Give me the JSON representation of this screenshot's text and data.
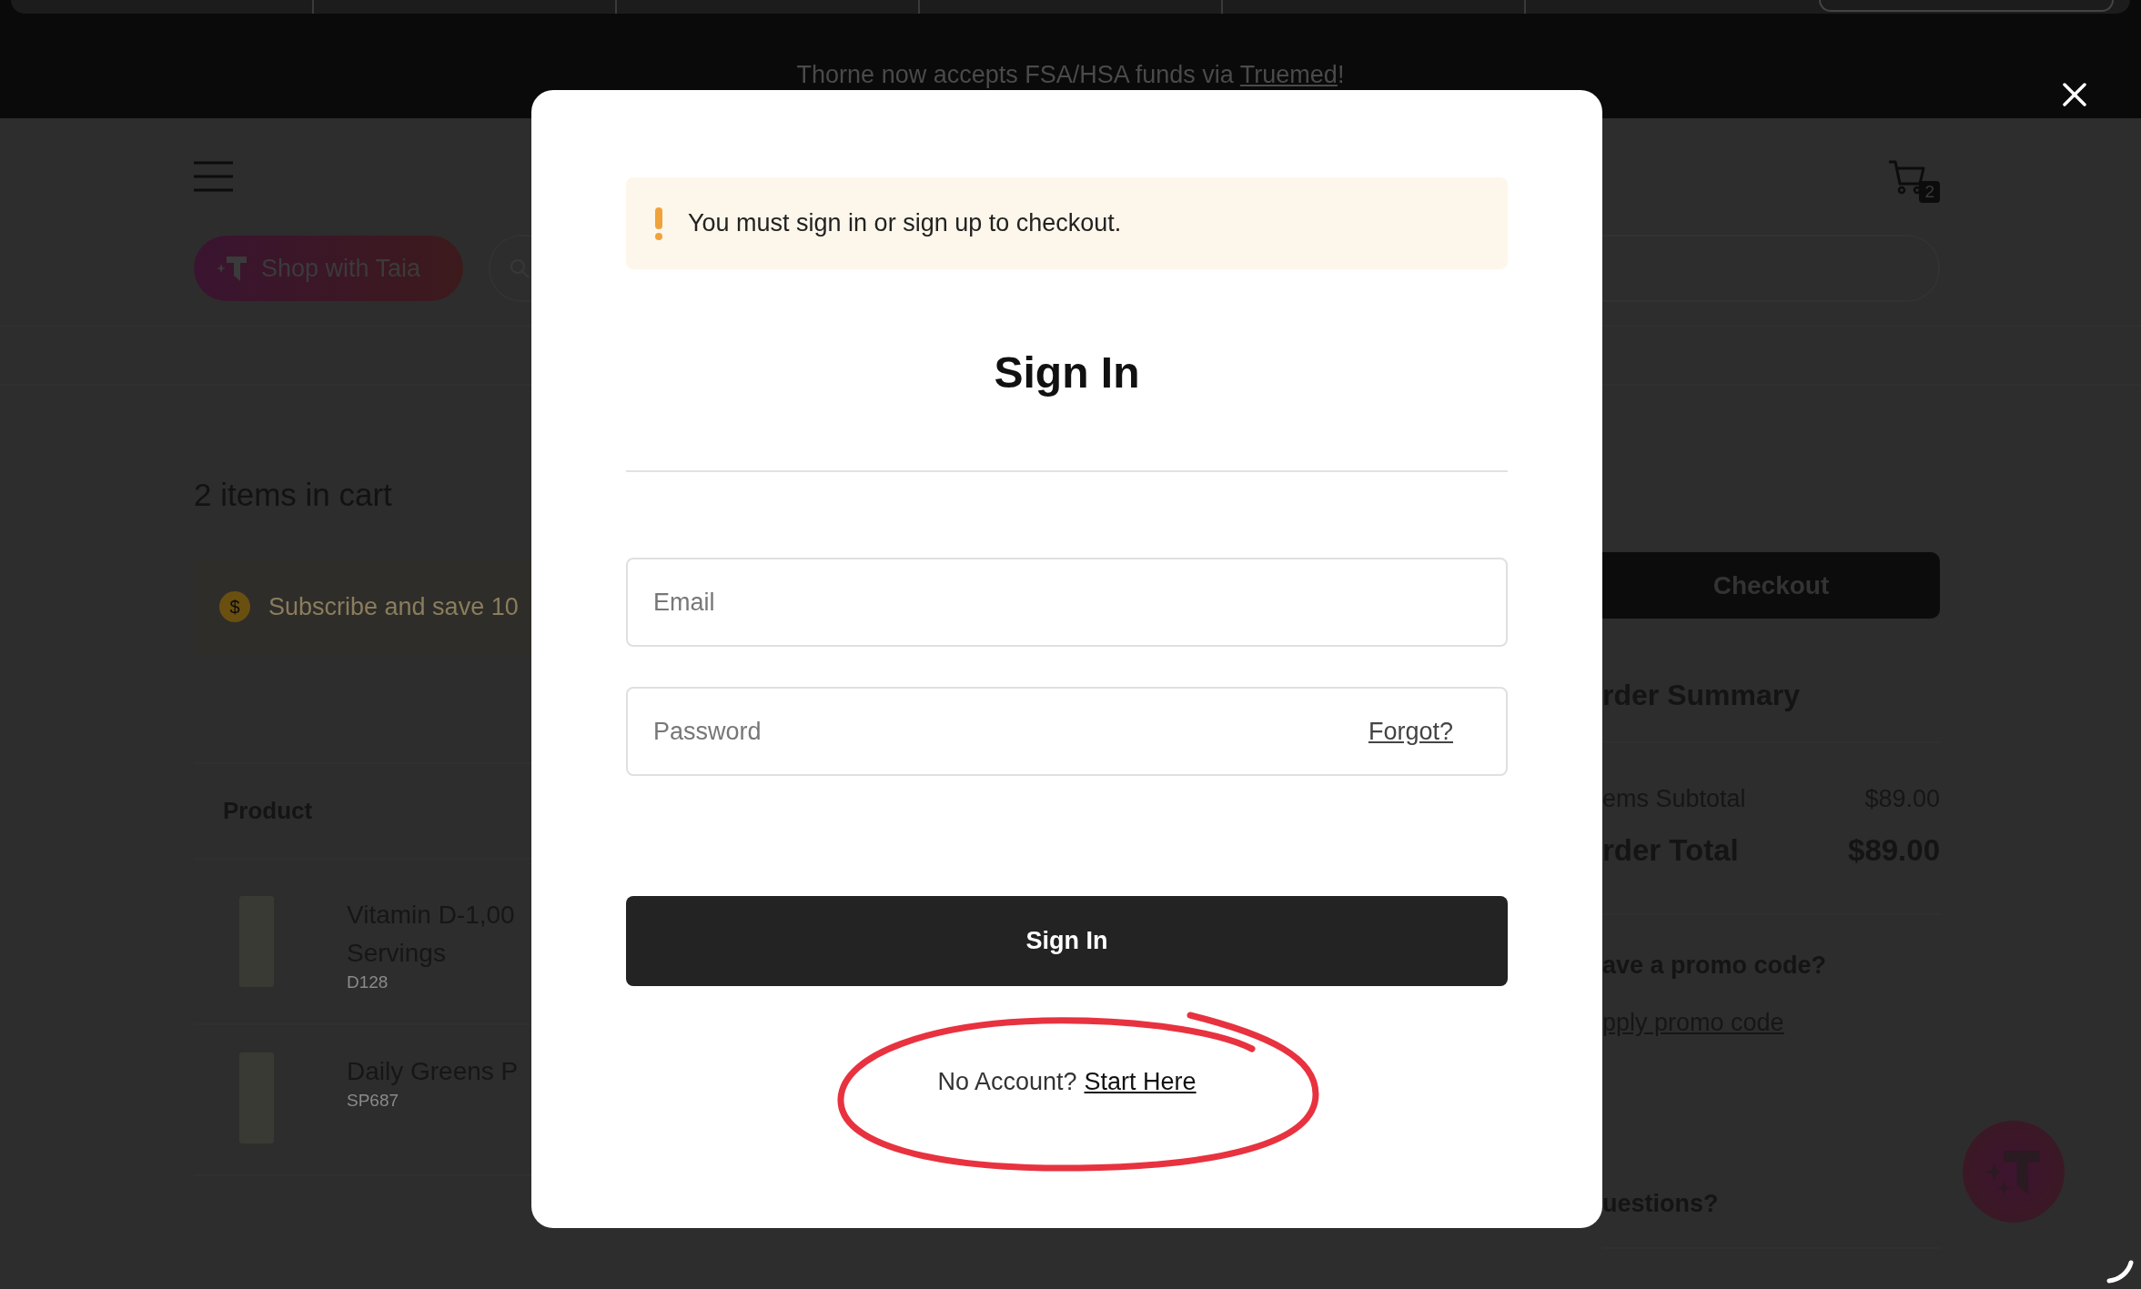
{
  "banner": {
    "text": "Thorne now accepts FSA/HSA funds via ",
    "link": "Truemed",
    "suffix": "!"
  },
  "header": {
    "shop_button": "Shop with Taia",
    "cart_count": "2"
  },
  "cart": {
    "heading": "2 items in cart",
    "subscribe": {
      "symbol": "$",
      "text": "Subscribe and save 10"
    },
    "table": {
      "columns": [
        "Product"
      ],
      "rows": [
        {
          "name_lines": [
            "Vitamin D-1,00",
            "Servings"
          ],
          "sku": "D128"
        },
        {
          "name_lines": [
            "Daily Greens P"
          ],
          "sku": "SP687"
        }
      ]
    }
  },
  "summary": {
    "checkout": "Checkout",
    "title": "rder Summary",
    "lines": [
      {
        "kind": "subtotal",
        "label": "ems Subtotal",
        "value": "$89.00"
      },
      {
        "kind": "total",
        "label": "rder Total",
        "value": "$89.00"
      }
    ],
    "promo_question": "ave a promo code?",
    "promo_link": "pply promo code",
    "questions": "uestions?"
  },
  "modal": {
    "alert": "You must sign in or sign up to checkout.",
    "title": "Sign In",
    "email": {
      "placeholder": "Email"
    },
    "password": {
      "placeholder": "Password",
      "forgot": "Forgot?"
    },
    "submit": "Sign In",
    "signup": {
      "text": "No Account?",
      "link": "Start Here"
    }
  }
}
